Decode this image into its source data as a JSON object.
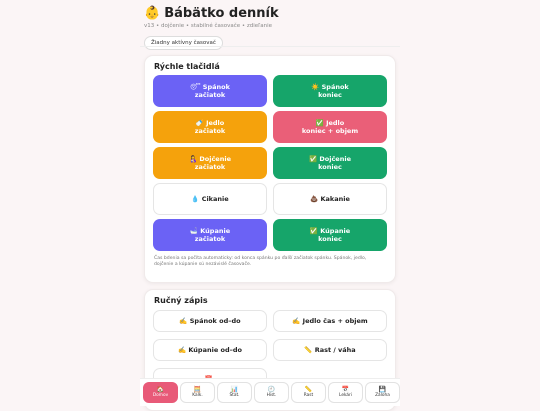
{
  "header": {
    "emoji": "👶",
    "title": "Bábätko denník",
    "subtitle": "v13 • dojčenie • stabilné časovače • zdieľanie",
    "timer_status": "Žiadny aktívny časovač"
  },
  "quick": {
    "title": "Rýchle tlačidlá",
    "buttons": [
      {
        "icon": "😴",
        "line1": "Spánok",
        "line2": "začiatok"
      },
      {
        "icon": "☀️",
        "line1": "Spánok",
        "line2": "koniec"
      },
      {
        "icon": "🍼",
        "line1": "Jedlo",
        "line2": "začiatok"
      },
      {
        "icon": "✅",
        "line1": "Jedlo",
        "line2": "koniec + objem"
      },
      {
        "icon": "🤱",
        "line1": "Dojčenie",
        "line2": "začiatok"
      },
      {
        "icon": "✅",
        "line1": "Dojčenie",
        "line2": "koniec"
      },
      {
        "icon": "💧",
        "line1": "Cikanie",
        "line2": ""
      },
      {
        "icon": "💩",
        "line1": "Kakanie",
        "line2": ""
      },
      {
        "icon": "🛁",
        "line1": "Kúpanie",
        "line2": "začiatok"
      },
      {
        "icon": "✅",
        "line1": "Kúpanie",
        "line2": "koniec"
      }
    ],
    "note": "Čas bdenia sa počíta automaticky: od konca spánku po ďalší začiatok spánku. Spánok, jedlo, dojčenie a kúpanie sú nezávislé časovače."
  },
  "manual": {
    "title": "Ručný zápis",
    "buttons": [
      {
        "icon": "✍️",
        "label": "Spánok od–do"
      },
      {
        "icon": "✍️",
        "label": "Jedlo čas + objem"
      },
      {
        "icon": "✍️",
        "label": "Kúpanie od–do"
      },
      {
        "icon": "📏",
        "label": "Rast / váha"
      },
      {
        "icon": "📅",
        "label": ""
      }
    ]
  },
  "nav": [
    {
      "icon": "🏠",
      "label": "Domov"
    },
    {
      "icon": "🧮",
      "label": "Kalk."
    },
    {
      "icon": "📊",
      "label": "Štat."
    },
    {
      "icon": "🕘",
      "label": "Hist."
    },
    {
      "icon": "📏",
      "label": "Rast"
    },
    {
      "icon": "📅",
      "label": "Lekári"
    },
    {
      "icon": "💾",
      "label": "Záloha"
    }
  ],
  "colors": {
    "purple": "#6b62f5",
    "green": "#16a56a",
    "orange": "#f5a20c",
    "pink": "#ea5f78",
    "nav_active": "#e85a78"
  }
}
